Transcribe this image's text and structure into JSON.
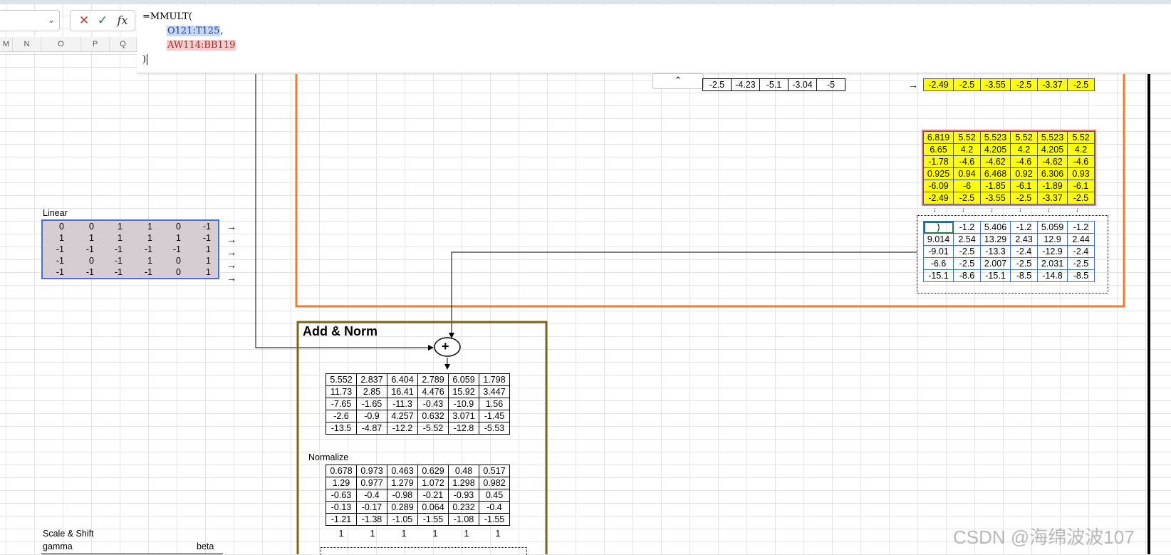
{
  "formula_bar": {
    "cancel_glyph": "✕",
    "enter_glyph": "✓",
    "fx_glyph": "fx",
    "line1": "=MMULT(",
    "ref1": "O121:T125",
    "comma": ",",
    "ref2": "AW114:BB119",
    "line3": ")"
  },
  "columns": [
    "M",
    "N",
    "O",
    "P",
    "Q"
  ],
  "icons": {
    "namebox": "chevron-down-icon",
    "collapse": "chevron-up-icon"
  },
  "top_partial_table": {
    "row": [
      "-2.5",
      "-4.23",
      "-5.1",
      "-3.04",
      "-5"
    ]
  },
  "top_yellow_row": {
    "arrow": "→",
    "row": [
      "-2.49",
      "-2.5",
      "-3.55",
      "-2.5",
      "-3.37",
      "-2.5"
    ]
  },
  "yellow_matrix": [
    [
      "6.819",
      "5.52",
      "5.523",
      "5.52",
      "5.523",
      "5.52"
    ],
    [
      "6.65",
      "4.2",
      "4.205",
      "4.2",
      "4.205",
      "4.2"
    ],
    [
      "-1.78",
      "-4.6",
      "-4.62",
      "-4.6",
      "-4.62",
      "-4.6"
    ],
    [
      "0.925",
      "0.94",
      "6.468",
      "0.92",
      "6.306",
      "0.93"
    ],
    [
      "-6.09",
      "-6",
      "-1.85",
      "-6.1",
      "-1.89",
      "-6.1"
    ],
    [
      "-2.49",
      "-2.5",
      "-3.55",
      "-2.5",
      "-3.37",
      "-2.5"
    ]
  ],
  "result_matrix": [
    [
      ")",
      "-1.2",
      "5.406",
      "-1.2",
      "5.059",
      "-1.2"
    ],
    [
      "9.014",
      "2.54",
      "13.29",
      "2.43",
      "12.9",
      "2.44"
    ],
    [
      "-9.01",
      "-2.5",
      "-13.3",
      "-2.4",
      "-12.9",
      "-2.4"
    ],
    [
      "-6.6",
      "-2.5",
      "2.007",
      "-2.5",
      "2.031",
      "-2.5"
    ],
    [
      "-15.1",
      "-8.6",
      "-15.1",
      "-8.5",
      "-14.8",
      "-8.5"
    ]
  ],
  "linear": {
    "label": "Linear",
    "arrow": "→",
    "matrix": [
      [
        "0",
        "0",
        "1",
        "1",
        "0",
        "-1"
      ],
      [
        "1",
        "1",
        "1",
        "1",
        "1",
        "-1"
      ],
      [
        "-1",
        "-1",
        "-1",
        "-1",
        "-1",
        "1"
      ],
      [
        "-1",
        "0",
        "-1",
        "1",
        "0",
        "1"
      ],
      [
        "-1",
        "-1",
        "-1",
        "-1",
        "0",
        "1"
      ]
    ]
  },
  "add_norm": {
    "title": "Add & Norm",
    "plus": "+",
    "sum_matrix": [
      [
        "5.552",
        "2.837",
        "6.404",
        "2.789",
        "6.059",
        "1.798"
      ],
      [
        "11.73",
        "2.85",
        "16.41",
        "4.476",
        "15.92",
        "3.447"
      ],
      [
        "-7.65",
        "-1.65",
        "-11.3",
        "-0.43",
        "-10.9",
        "1.56"
      ],
      [
        "-2.6",
        "-0.9",
        "4.257",
        "0.632",
        "3.071",
        "-1.45"
      ],
      [
        "-13.5",
        "-4.87",
        "-12.2",
        "-5.52",
        "-12.8",
        "-5.53"
      ]
    ],
    "normalize_label": "Normalize",
    "norm_matrix": [
      [
        "0.678",
        "0.973",
        "0.463",
        "0.629",
        "0.48",
        "0.517"
      ],
      [
        "1.29",
        "0.977",
        "1.279",
        "1.072",
        "1.298",
        "0.982"
      ],
      [
        "-0.63",
        "-0.4",
        "-0.98",
        "-0.21",
        "-0.93",
        "0.45"
      ],
      [
        "-0.13",
        "-0.17",
        "0.289",
        "0.064",
        "0.232",
        "-0.4"
      ],
      [
        "-1.21",
        "-1.38",
        "-1.05",
        "-1.55",
        "-1.08",
        "-1.55"
      ]
    ],
    "ones_row": [
      "1",
      "1",
      "1",
      "1",
      "1",
      "1"
    ]
  },
  "scale_shift": {
    "label": "Scale & Shift",
    "gamma": "gamma",
    "beta": "beta"
  },
  "watermark": "CSDN @海绵波波107",
  "colors": {
    "orange": "#ee7d31",
    "olive": "#7f6415",
    "yellow": "#ffff00",
    "selection_blue": "#4a6fd0"
  }
}
